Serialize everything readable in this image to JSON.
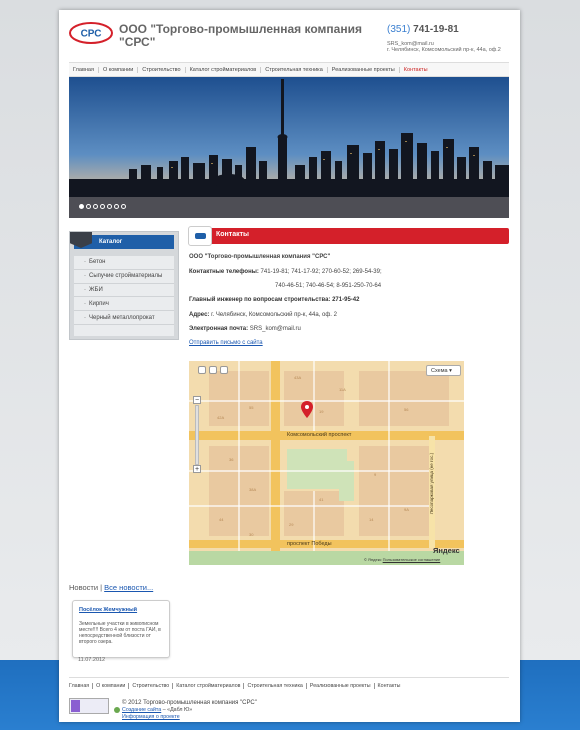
{
  "header": {
    "company_name": "ООО \"Торгово-промышленная компания \"СРС\"",
    "phone_code": "(351)",
    "phone_number": "741-19-81",
    "email": "SRS_kom@mail.ru",
    "address": "г. Челябинск, Комсомольский пр-к, 44а, оф.2",
    "logo_text": "СРС"
  },
  "nav": {
    "items": [
      "Главная",
      "О компании",
      "Строительство",
      "Каталог стройматериалов",
      "Строительная техника",
      "Реализованные проекты",
      "Контакты"
    ]
  },
  "slider": {
    "dot_count": 7,
    "active_dot": 0
  },
  "catalog": {
    "title": "Каталог",
    "items": [
      "Бетон",
      "Сыпучие стройматериалы",
      "ЖБИ",
      "Кирпич",
      "Черный металлопрокат"
    ]
  },
  "contacts": {
    "title": "Контакты",
    "company": "ООО \"Торгово-промышленная компания \"СРС\"",
    "phones_label": "Контактные телефоны:",
    "phones_line1": "741-19-81; 741-17-92; 270-60-52; 269-54-39;",
    "phones_line2": "740-46-51; 740-46-54;  8-951-250-70-64",
    "engineer_label": "Главный инженер по вопросам строительства:",
    "engineer_phone": "271-95-42",
    "address_label": "Адрес:",
    "address": "г. Челябинск, Комсомольский пр-к, 44а, оф. 2",
    "email_label": "Электронная почта:",
    "email": "SRS_kom@mail.ru",
    "send_link": "Отправить письмо с сайта"
  },
  "map": {
    "scheme_button": "Схема",
    "street_main": "Комсомольский проспект",
    "street_bottom": "проспект Победы",
    "street_vertical": "Лесопарковая улица (не гос.)",
    "brand": "Яндекс",
    "copyright": "© Яндекс",
    "agreement": "Пользовательское соглашение"
  },
  "news": {
    "label": "Новости",
    "all_link": "Все новости...",
    "item_title": "Посёлок Жемчужный",
    "item_text": "Земельные участки в живописном месте!!!! Всего 4 км от поста ГАИ, в непосредственной близости от второго озера.",
    "item_date": "11.07.2012"
  },
  "footer": {
    "nav": [
      "Главная",
      "О компании",
      "Строительство",
      "Каталог стройматериалов",
      "Строительная техника",
      "Реализованные проекты",
      "Контакты"
    ],
    "copyright": "© 2012 Торгово-промышленная компания \"СРС\"",
    "creator_label": "Создание сайта",
    "creator_name": " – «Дабл Ю»",
    "project_info": "Информация о проекте"
  },
  "colors": {
    "accent_red": "#d4202a",
    "brand_blue": "#1f5fa8",
    "link": "#1a57b0"
  }
}
